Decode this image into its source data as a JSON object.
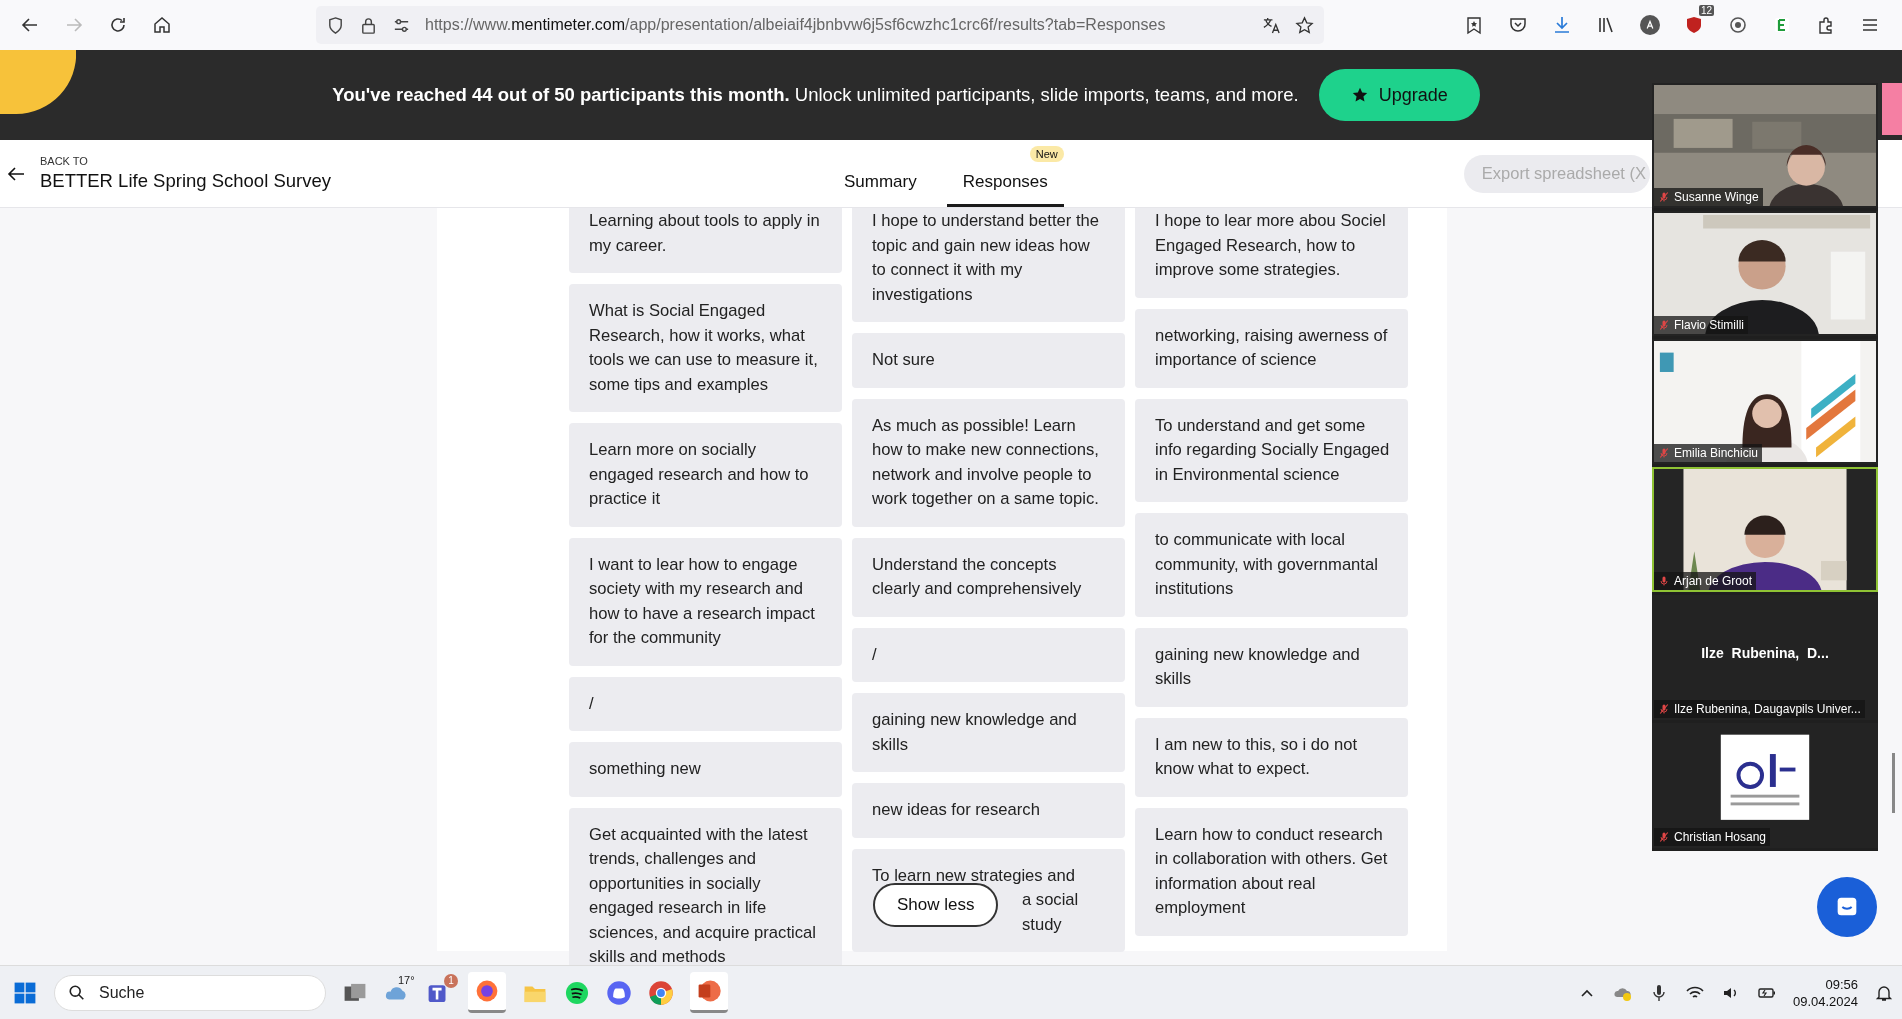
{
  "browser": {
    "url_host": "https://www.",
    "url_domain": "mentimeter.com",
    "url_path": "/app/presentation/albeiaif4jbnbvw6j5sf6cwzhc1crc6f/results?tab=Responses",
    "forward_disabled": true,
    "extension_badge": "12"
  },
  "banner": {
    "text": "**You've reached 44 out of 50 participants this month.** Unlock unlimited participants, slide imports, teams, and more.",
    "button": "Upgrade"
  },
  "header": {
    "back_label": "BACK TO",
    "title": "BETTER Life Spring School Survey",
    "tabs": [
      {
        "label": "Summary",
        "selected": false
      },
      {
        "label": "Responses",
        "selected": true,
        "badge": "New"
      }
    ],
    "export": {
      "label": "Export spreadsheet (X",
      "disabled": true
    }
  },
  "columns": [
    [
      "Learning about tools to apply in my career.",
      "What is Social Engaged Research, how it works, what tools we can use to measure it, some tips and examples",
      "Learn more on socially engaged research and how to practice it",
      "I want to lear how to engage society with my research and how to have a research impact for the community",
      "/",
      "something new",
      "Get acquainted with the latest trends, challenges and opportunities in socially engaged research in life sciences, and acquire practical skills and methods"
    ],
    [
      "I hope to understand better the topic and gain new ideas how to connect it with my investigations",
      "Not sure",
      "As much as possible! Learn how to make new connections, network and involve people to work together on a same topic.",
      "Understand the concepts clearly and comprehensively",
      "/",
      "gaining new knowledge and skills",
      "new ideas for research",
      {
        "lead": "To learn new strategies and",
        "tail": "a social study"
      }
    ],
    [
      "I hope to lear more abou Sociel Engaged Research, how to improve some strategies.",
      "networking, raising awerness of importance of science",
      "To understand and get some info regarding Socially Engaged in Environmental science",
      "to communicate with local community, with governmantal institutions",
      "gaining new knowledge and skills",
      "I am new to this, so i do not know what to expect.",
      "Learn how to conduct research in collaboration with others. Get information about real employment"
    ]
  ],
  "show_less": "Show less",
  "participants": [
    {
      "name": "Susanne Winge",
      "kind": "video",
      "muted": true,
      "speaking": false
    },
    {
      "name": "Flavio Stimilli",
      "kind": "video",
      "muted": true,
      "speaking": false
    },
    {
      "name": "Emilia Binchiciu",
      "kind": "video",
      "muted": true,
      "speaking": false
    },
    {
      "name": "Arjan de Groot",
      "kind": "video",
      "muted": false,
      "speaking": true
    },
    {
      "name": "Ilze Rubenina, Daugavpils Univer...",
      "kind": "name",
      "display": "Ilze  Rubenina,  D...",
      "muted": true,
      "speaking": false
    },
    {
      "name": "Christian Hosang",
      "kind": "video",
      "muted": true,
      "speaking": false
    }
  ],
  "taskbar": {
    "search_placeholder": "Suche",
    "weather": "17°",
    "teams_badge": "1",
    "time": "09:56",
    "date": "09.04.2024"
  }
}
